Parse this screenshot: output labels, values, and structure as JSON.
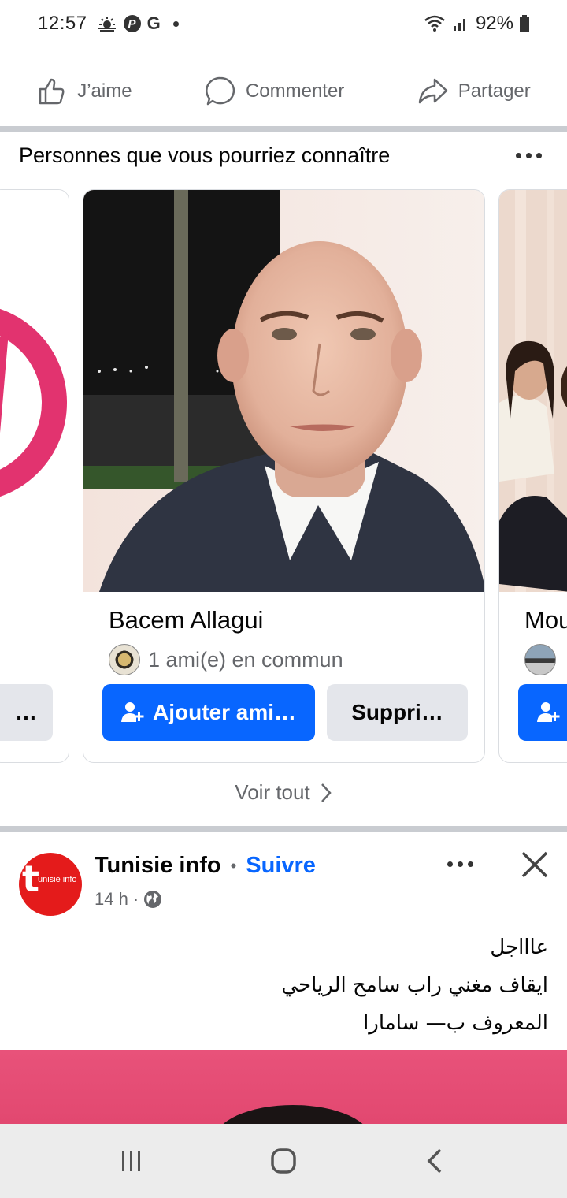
{
  "status_bar": {
    "time": "12:57",
    "battery": "92%",
    "icons": [
      "weather-icon",
      "p-app-icon",
      "google-icon",
      "notification-dot-icon",
      "wifi-icon",
      "signal-icon",
      "battery-icon"
    ]
  },
  "actions": {
    "like": "J’aime",
    "comment": "Commenter",
    "share": "Partager"
  },
  "pymk": {
    "title": "Personnes que vous pourriez connaître",
    "cards": [
      {
        "name": "",
        "secondary_label": "…"
      },
      {
        "name": "Bacem Allagui",
        "mutual": "1 ami(e) en commun",
        "add_label": "Ajouter ami…",
        "remove_label": "Suppri…"
      },
      {
        "name": "Mou",
        "mutual": ""
      }
    ],
    "see_all": "Voir tout"
  },
  "post": {
    "author": "Tunisie info",
    "avatar_letter": "t",
    "avatar_text": "unisie info",
    "separator": "•",
    "follow": "Suivre",
    "time": "14 h",
    "meta_sep": "·",
    "text_lines": [
      "عاااجل",
      "ايقاف مغني راب سامح الرياحي",
      "المعروف ب— سامارا"
    ]
  },
  "colors": {
    "facebook_blue": "#0866ff",
    "secondary_gray": "#e4e6eb",
    "divider": "#c9ccd1",
    "muted_text": "#65676b"
  }
}
